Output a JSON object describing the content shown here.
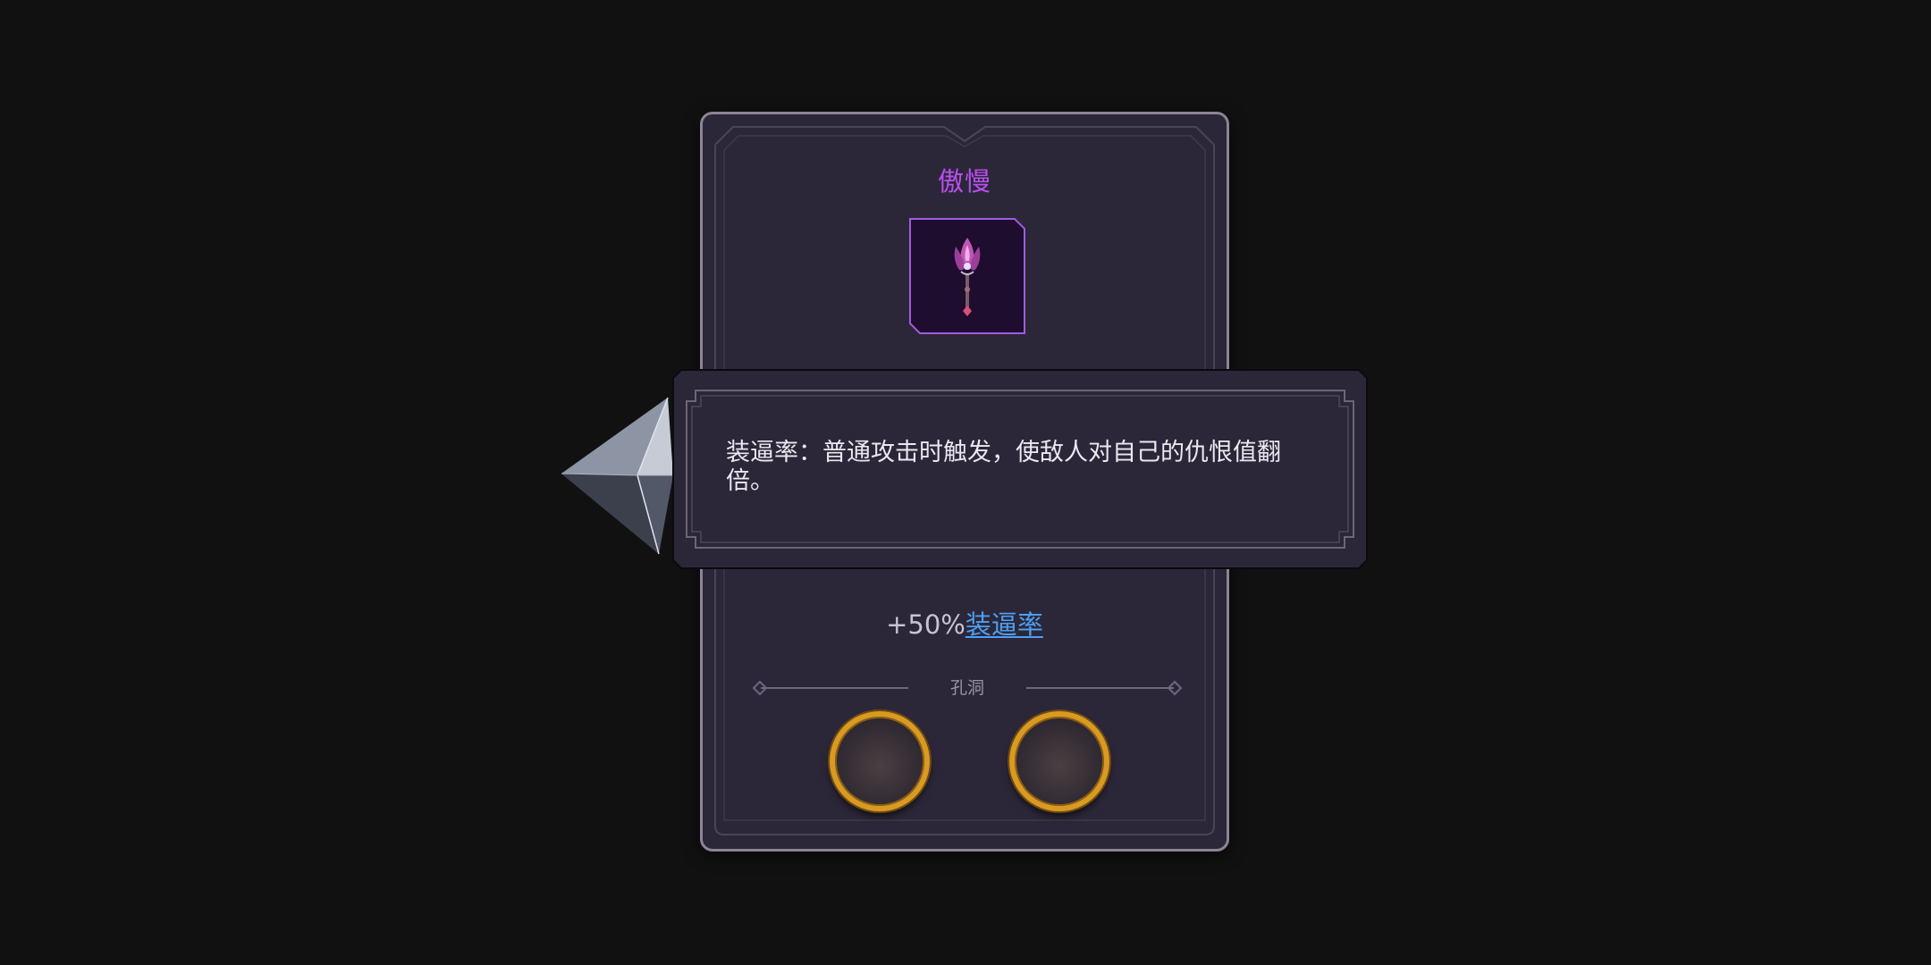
{
  "item": {
    "name": "傲慢",
    "icon": "pink-lotus-scepter-icon",
    "stat_prefix": "+50%",
    "stat_link": "装逼率"
  },
  "sockets": {
    "label": "孔洞",
    "slots": [
      "empty",
      "empty"
    ]
  },
  "tooltip": {
    "text": "装逼率：普通攻击时触发，使敌人对自己的仇恨值翻倍。"
  },
  "colors": {
    "title": "#b84ff0",
    "link": "#4d9ff2",
    "socket_ring": "#d99a22",
    "card_bg": "#2c2738"
  }
}
